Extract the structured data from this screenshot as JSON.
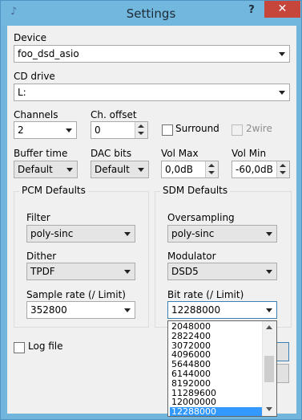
{
  "window": {
    "title": "Settings",
    "help_glyph": "?",
    "close_glyph": "✕",
    "app_icon_glyph": "♪"
  },
  "device": {
    "label": "Device",
    "value": "foo_dsd_asio"
  },
  "cd_drive": {
    "label": "CD drive",
    "value": "L:"
  },
  "channels": {
    "label": "Channels",
    "value": "2"
  },
  "ch_offset": {
    "label": "Ch. offset",
    "value": "0"
  },
  "surround": {
    "label": "Surround",
    "checked": false
  },
  "two_wire": {
    "label": "2wire",
    "checked": false,
    "enabled": false
  },
  "buffer_time": {
    "label": "Buffer time",
    "value": "Default"
  },
  "dac_bits": {
    "label": "DAC bits",
    "value": "Default"
  },
  "vol_max": {
    "label": "Vol Max",
    "value": "0,0dB"
  },
  "vol_min": {
    "label": "Vol Min",
    "value": "-60,0dB"
  },
  "pcm": {
    "title": "PCM Defaults",
    "filter": {
      "label": "Filter",
      "value": "poly-sinc"
    },
    "dither": {
      "label": "Dither",
      "value": "TPDF"
    },
    "sample_rate": {
      "label": "Sample rate (/ Limit)",
      "value": "352800"
    }
  },
  "sdm": {
    "title": "SDM Defaults",
    "oversampling": {
      "label": "Oversampling",
      "value": "poly-sinc"
    },
    "modulator": {
      "label": "Modulator",
      "value": "DSD5"
    },
    "bit_rate": {
      "label": "Bit rate (/ Limit)",
      "value": "12288000",
      "options": [
        "2048000",
        "2822400",
        "3072000",
        "4096000",
        "5644800",
        "6144000",
        "8192000",
        "11289600",
        "12000000",
        "12288000"
      ],
      "selected_index": 9
    }
  },
  "log_file": {
    "label": "Log file",
    "checked": false
  },
  "colors": {
    "titlebar": "#72b7dd",
    "close": "#c7463c",
    "selection": "#3399ff"
  }
}
